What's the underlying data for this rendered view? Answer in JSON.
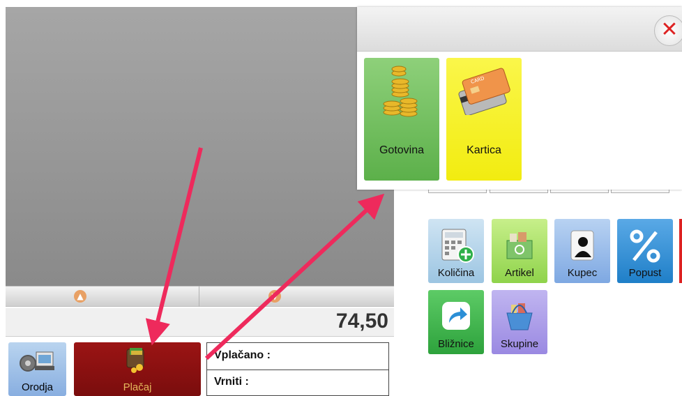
{
  "pos": {
    "total": "74,50",
    "tools_label": "Orodja",
    "pay_label": "Plačaj",
    "paid_label": "Vplačano :",
    "change_label": "Vrniti :"
  },
  "popup": {
    "close_icon": "close-icon",
    "methods": [
      {
        "label": "Gotovina",
        "icon": "coins-icon",
        "color": "#6ab85a"
      },
      {
        "label": "Kartica",
        "icon": "credit-card-icon",
        "color": "#f7f21a"
      }
    ]
  },
  "functions": [
    {
      "label": "Količina",
      "icon": "calculator-icon",
      "color": "#a7cde6"
    },
    {
      "label": "Artikel",
      "icon": "basket-icon",
      "color": "#a5e05a"
    },
    {
      "label": "Kupec",
      "icon": "person-icon",
      "color": "#8ab4e8"
    },
    {
      "label": "Popust",
      "icon": "percent-icon",
      "color": "#2d8fd8"
    },
    {
      "label": "Bližnice",
      "icon": "shortcut-arrow-icon",
      "color": "#3cb04a"
    },
    {
      "label": "Skupine",
      "icon": "basket-icon",
      "color": "#a494e6"
    }
  ]
}
